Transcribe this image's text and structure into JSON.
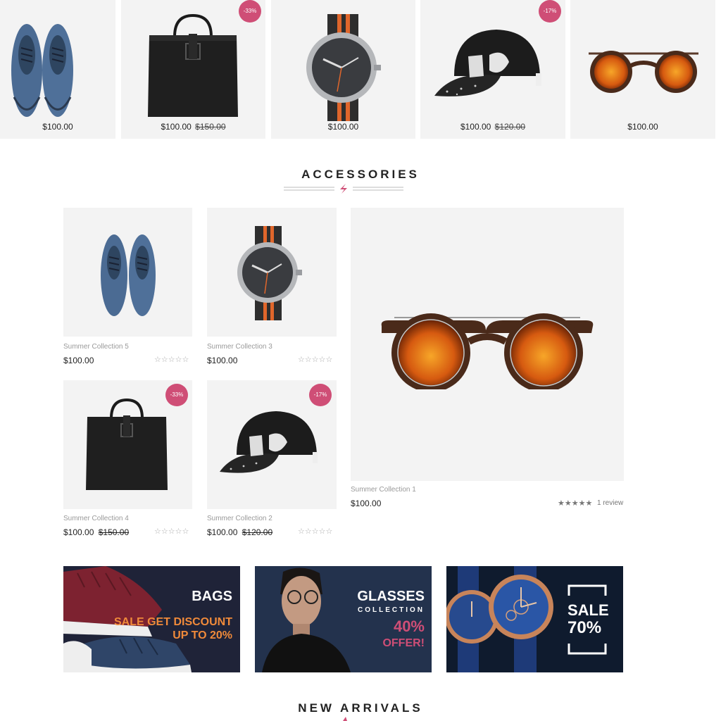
{
  "top_row": [
    {
      "name": "shoes",
      "price": "$100.00"
    },
    {
      "name": "bag",
      "price": "$100.00",
      "old_price": "$150.00",
      "badge": "-33%"
    },
    {
      "name": "watch",
      "price": "$100.00"
    },
    {
      "name": "cap",
      "price": "$100.00",
      "old_price": "$120.00",
      "badge": "-17%"
    },
    {
      "name": "sunglasses",
      "price": "$100.00"
    }
  ],
  "accessories": {
    "title": "ACCESSORIES",
    "products": [
      {
        "name": "Summer Collection 5",
        "price": "$100.00"
      },
      {
        "name": "Summer Collection 3",
        "price": "$100.00"
      },
      {
        "name": "Summer Collection 4",
        "price": "$100.00",
        "old_price": "$150.00",
        "badge": "-33%"
      },
      {
        "name": "Summer Collection 2",
        "price": "$100.00",
        "old_price": "$120.00",
        "badge": "-17%"
      }
    ],
    "featured": {
      "name": "Summer Collection 1",
      "price": "$100.00",
      "stars": "★★★★★",
      "review": "1 review"
    },
    "empty_stars": "☆☆☆☆☆"
  },
  "banners": [
    {
      "title": "BAGS",
      "line1": "SALE GET DISCOUNT",
      "line2": "UP TO 20%"
    },
    {
      "title": "GLASSES",
      "subtitle": "COLLECTION",
      "line1": "40%",
      "line2": "OFFER!"
    },
    {
      "title": "SALE",
      "line1": "70%"
    }
  ],
  "new_arrivals": {
    "title": "NEW ARRIVALS"
  },
  "colors": {
    "badge": "#cf4e76",
    "accent": "#f08a3a",
    "navy": "#1e2336",
    "card_bg": "#f3f3f3"
  }
}
